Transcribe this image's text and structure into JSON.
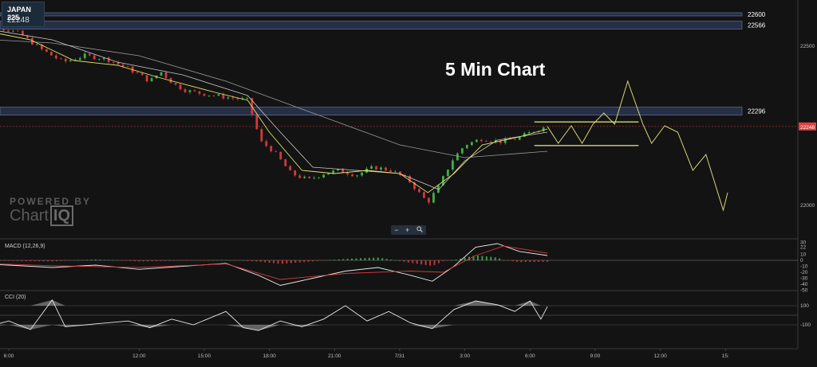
{
  "symbol": {
    "name": "JAPAN 225",
    "price": "22248"
  },
  "headline": "5 Min Chart",
  "watermark": {
    "line1": "POWERED BY",
    "line2a": "Chart",
    "line2b": "IQ"
  },
  "zoom": {
    "minus": "−",
    "plus": "+",
    "reset_icon": "magnifier-icon"
  },
  "panes": {
    "macd_label": "MACD (12,26,9)",
    "cci_label": "CCI (20)"
  },
  "colors": {
    "background": "#131313",
    "candle_up": "#3fae49",
    "candle_down": "#d33a3a",
    "ma_fast": "#e6e36a",
    "ma_mid": "#c8c8c8",
    "level_band": "#36476f",
    "projection": "#d6d27a",
    "current_price": "#e04040"
  },
  "chart_data": [
    {
      "type": "candlestick",
      "title": "5 Min Chart",
      "ylim": [
        21960,
        22640
      ],
      "y_ticks": [
        22000,
        22500
      ],
      "x_tick_labels": [
        "6:00",
        "12:00",
        "15:00",
        "18:00",
        "21:00",
        "7/31",
        "3:00",
        "6:00",
        "9:00",
        "12:00",
        "15:"
      ],
      "x_tick_hours": [
        6,
        12,
        15,
        18,
        21,
        24,
        27,
        30,
        33,
        36,
        39
      ],
      "level_lines": [
        {
          "value": 22600,
          "label": "22600"
        },
        {
          "value": 22566,
          "label": "22566"
        },
        {
          "value": 22296,
          "label": "22296"
        }
      ],
      "current_price": {
        "value": 22248,
        "label": "22248"
      },
      "price_path": [
        {
          "hour": 4.0,
          "price": 22555
        },
        {
          "hour": 5.5,
          "price": 22560
        },
        {
          "hour": 6.5,
          "price": 22540
        },
        {
          "hour": 7.5,
          "price": 22490
        },
        {
          "hour": 8.5,
          "price": 22450
        },
        {
          "hour": 9.5,
          "price": 22470
        },
        {
          "hour": 10.5,
          "price": 22460
        },
        {
          "hour": 11.5,
          "price": 22430
        },
        {
          "hour": 12.5,
          "price": 22390
        },
        {
          "hour": 13.0,
          "price": 22420
        },
        {
          "hour": 13.6,
          "price": 22380
        },
        {
          "hour": 14.2,
          "price": 22360
        },
        {
          "hour": 15.0,
          "price": 22350
        },
        {
          "hour": 16.0,
          "price": 22340
        },
        {
          "hour": 17.0,
          "price": 22330
        },
        {
          "hour": 17.6,
          "price": 22200
        },
        {
          "hour": 18.2,
          "price": 22170
        },
        {
          "hour": 19.0,
          "price": 22100
        },
        {
          "hour": 19.8,
          "price": 22080
        },
        {
          "hour": 20.5,
          "price": 22100
        },
        {
          "hour": 21.2,
          "price": 22110
        },
        {
          "hour": 22.0,
          "price": 22095
        },
        {
          "hour": 22.8,
          "price": 22120
        },
        {
          "hour": 23.6,
          "price": 22110
        },
        {
          "hour": 24.4,
          "price": 22080
        },
        {
          "hour": 25.0,
          "price": 22030
        },
        {
          "hour": 25.3,
          "price": 22010
        },
        {
          "hour": 25.8,
          "price": 22060
        },
        {
          "hour": 26.4,
          "price": 22140
        },
        {
          "hour": 27.0,
          "price": 22190
        },
        {
          "hour": 27.8,
          "price": 22210
        },
        {
          "hour": 28.6,
          "price": 22200
        },
        {
          "hour": 29.4,
          "price": 22210
        },
        {
          "hour": 30.2,
          "price": 22235
        },
        {
          "hour": 30.8,
          "price": 22248
        }
      ],
      "ma_fast": [
        {
          "hour": 4.0,
          "price": 22560
        },
        {
          "hour": 7.0,
          "price": 22520
        },
        {
          "hour": 9.0,
          "price": 22455
        },
        {
          "hour": 11.0,
          "price": 22440
        },
        {
          "hour": 13.0,
          "price": 22400
        },
        {
          "hour": 15.5,
          "price": 22355
        },
        {
          "hour": 17.0,
          "price": 22330
        },
        {
          "hour": 18.0,
          "price": 22230
        },
        {
          "hour": 19.5,
          "price": 22110
        },
        {
          "hour": 21.0,
          "price": 22100
        },
        {
          "hour": 22.5,
          "price": 22110
        },
        {
          "hour": 24.0,
          "price": 22100
        },
        {
          "hour": 25.3,
          "price": 22040
        },
        {
          "hour": 26.5,
          "price": 22100
        },
        {
          "hour": 27.8,
          "price": 22190
        },
        {
          "hour": 29.5,
          "price": 22215
        },
        {
          "hour": 30.8,
          "price": 22240
        }
      ],
      "ma_mid": [
        {
          "hour": 4.0,
          "price": 22565
        },
        {
          "hour": 8.0,
          "price": 22520
        },
        {
          "hour": 11.0,
          "price": 22450
        },
        {
          "hour": 14.0,
          "price": 22410
        },
        {
          "hour": 17.0,
          "price": 22345
        },
        {
          "hour": 18.5,
          "price": 22230
        },
        {
          "hour": 20.0,
          "price": 22120
        },
        {
          "hour": 22.0,
          "price": 22110
        },
        {
          "hour": 24.0,
          "price": 22100
        },
        {
          "hour": 25.8,
          "price": 22050
        },
        {
          "hour": 27.0,
          "price": 22140
        },
        {
          "hour": 28.5,
          "price": 22205
        },
        {
          "hour": 30.8,
          "price": 22230
        }
      ],
      "ma_slow": [
        {
          "hour": 4.0,
          "price": 22525
        },
        {
          "hour": 8.0,
          "price": 22510
        },
        {
          "hour": 12.0,
          "price": 22470
        },
        {
          "hour": 16.0,
          "price": 22390
        },
        {
          "hour": 20.0,
          "price": 22290
        },
        {
          "hour": 24.0,
          "price": 22190
        },
        {
          "hour": 27.0,
          "price": 22150
        },
        {
          "hour": 30.8,
          "price": 22170
        }
      ],
      "range_box": {
        "hour_start": 30.2,
        "hour_end": 35.0,
        "high": 22262,
        "low": 22188
      },
      "projection": [
        {
          "hour": 30.8,
          "price": 22248
        },
        {
          "hour": 31.3,
          "price": 22195
        },
        {
          "hour": 31.9,
          "price": 22250
        },
        {
          "hour": 32.4,
          "price": 22195
        },
        {
          "hour": 32.9,
          "price": 22255
        },
        {
          "hour": 33.4,
          "price": 22290
        },
        {
          "hour": 33.9,
          "price": 22255
        },
        {
          "hour": 34.5,
          "price": 22390
        },
        {
          "hour": 35.2,
          "price": 22255
        },
        {
          "hour": 35.6,
          "price": 22195
        },
        {
          "hour": 36.2,
          "price": 22250
        },
        {
          "hour": 36.8,
          "price": 22230
        },
        {
          "hour": 37.5,
          "price": 22110
        },
        {
          "hour": 38.1,
          "price": 22160
        },
        {
          "hour": 38.9,
          "price": 21985
        },
        {
          "hour": 39.1,
          "price": 22040
        }
      ]
    },
    {
      "type": "line",
      "title": "MACD (12,26,9)",
      "ylim": [
        -55,
        55
      ],
      "y_ticks": [
        30,
        22,
        10,
        0,
        -10,
        -20,
        -30,
        -40,
        -50
      ],
      "macd": [
        {
          "hour": 4.0,
          "v": -5
        },
        {
          "hour": 6.0,
          "v": -8
        },
        {
          "hour": 8.0,
          "v": -12
        },
        {
          "hour": 10.0,
          "v": -8
        },
        {
          "hour": 12.0,
          "v": -15
        },
        {
          "hour": 14.0,
          "v": -10
        },
        {
          "hour": 16.0,
          "v": -5
        },
        {
          "hour": 17.5,
          "v": -25
        },
        {
          "hour": 18.5,
          "v": -42
        },
        {
          "hour": 20.0,
          "v": -30
        },
        {
          "hour": 21.5,
          "v": -18
        },
        {
          "hour": 23.0,
          "v": -12
        },
        {
          "hour": 24.5,
          "v": -25
        },
        {
          "hour": 25.5,
          "v": -35
        },
        {
          "hour": 26.5,
          "v": -10
        },
        {
          "hour": 27.5,
          "v": 22
        },
        {
          "hour": 28.5,
          "v": 28
        },
        {
          "hour": 29.5,
          "v": 15
        },
        {
          "hour": 30.8,
          "v": 8
        }
      ],
      "signal": [
        {
          "hour": 4.0,
          "v": -4
        },
        {
          "hour": 8.0,
          "v": -9
        },
        {
          "hour": 12.0,
          "v": -12
        },
        {
          "hour": 16.0,
          "v": -6
        },
        {
          "hour": 18.5,
          "v": -32
        },
        {
          "hour": 21.5,
          "v": -22
        },
        {
          "hour": 24.5,
          "v": -18
        },
        {
          "hour": 26.0,
          "v": -20
        },
        {
          "hour": 27.5,
          "v": 8
        },
        {
          "hour": 28.8,
          "v": 24
        },
        {
          "hour": 30.8,
          "v": 12
        }
      ]
    },
    {
      "type": "line",
      "title": "CCI (20)",
      "ylim": [
        -180,
        180
      ],
      "y_ticks": [
        100,
        -100
      ],
      "cci": [
        {
          "hour": 4.0,
          "v": -40
        },
        {
          "hour": 5.0,
          "v": -120
        },
        {
          "hour": 6.0,
          "v": -60
        },
        {
          "hour": 7.0,
          "v": -150
        },
        {
          "hour": 8.0,
          "v": 160
        },
        {
          "hour": 8.6,
          "v": -120
        },
        {
          "hour": 10.0,
          "v": -90
        },
        {
          "hour": 11.5,
          "v": -60
        },
        {
          "hour": 12.5,
          "v": -130
        },
        {
          "hour": 13.5,
          "v": -40
        },
        {
          "hour": 14.5,
          "v": -100
        },
        {
          "hour": 16.0,
          "v": 40
        },
        {
          "hour": 16.8,
          "v": -130
        },
        {
          "hour": 17.5,
          "v": -160
        },
        {
          "hour": 18.5,
          "v": -60
        },
        {
          "hour": 19.5,
          "v": -120
        },
        {
          "hour": 20.5,
          "v": -40
        },
        {
          "hour": 21.5,
          "v": 100
        },
        {
          "hour": 22.5,
          "v": -60
        },
        {
          "hour": 23.5,
          "v": 40
        },
        {
          "hour": 24.5,
          "v": -80
        },
        {
          "hour": 25.5,
          "v": -140
        },
        {
          "hour": 26.5,
          "v": 60
        },
        {
          "hour": 27.5,
          "v": 150
        },
        {
          "hour": 28.5,
          "v": 110
        },
        {
          "hour": 29.3,
          "v": 40
        },
        {
          "hour": 30.0,
          "v": 150
        },
        {
          "hour": 30.5,
          "v": -40
        },
        {
          "hour": 30.8,
          "v": 90
        }
      ]
    }
  ]
}
